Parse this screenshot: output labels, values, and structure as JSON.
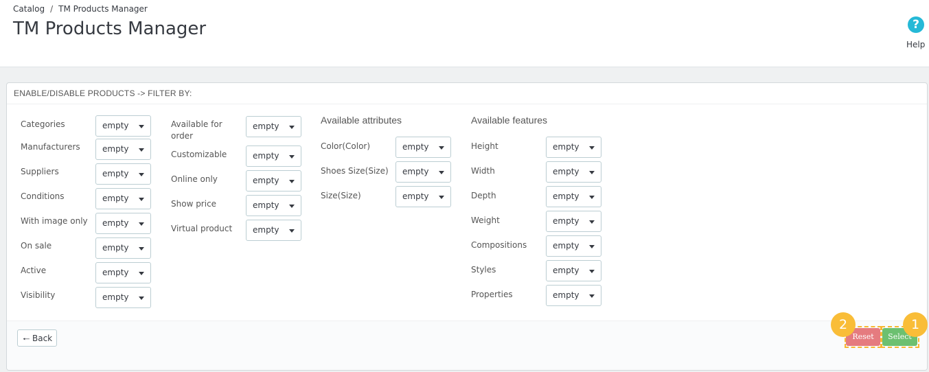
{
  "breadcrumb": {
    "parent": "Catalog",
    "separator": "/",
    "current": "TM Products Manager"
  },
  "page_title": "TM Products Manager",
  "help": {
    "icon": "?",
    "label": "Help"
  },
  "panel": {
    "heading": "ENABLE/DISABLE PRODUCTS -> FILTER BY:",
    "col1": [
      {
        "label": "Categories",
        "value": "empty"
      },
      {
        "label": "Manufacturers",
        "value": "empty"
      },
      {
        "label": "Suppliers",
        "value": "empty"
      },
      {
        "label": "Conditions",
        "value": "empty"
      },
      {
        "label": "With image only",
        "value": "empty"
      },
      {
        "label": "On sale",
        "value": "empty"
      },
      {
        "label": "Active",
        "value": "empty"
      },
      {
        "label": "Visibility",
        "value": "empty"
      }
    ],
    "col2": [
      {
        "label": "Available for order",
        "value": "empty"
      },
      {
        "label": "Customizable",
        "value": "empty"
      },
      {
        "label": "Online only",
        "value": "empty"
      },
      {
        "label": "Show price",
        "value": "empty"
      },
      {
        "label": "Virtual product",
        "value": "empty"
      }
    ],
    "attributes": {
      "title": "Available attributes",
      "items": [
        {
          "label": "Color(Color)",
          "value": "empty"
        },
        {
          "label": "Shoes Size(Size)",
          "value": "empty"
        },
        {
          "label": "Size(Size)",
          "value": "empty"
        }
      ]
    },
    "features": {
      "title": "Available features",
      "items": [
        {
          "label": "Height",
          "value": "empty"
        },
        {
          "label": "Width",
          "value": "empty"
        },
        {
          "label": "Depth",
          "value": "empty"
        },
        {
          "label": "Weight",
          "value": "empty"
        },
        {
          "label": "Compositions",
          "value": "empty"
        },
        {
          "label": "Styles",
          "value": "empty"
        },
        {
          "label": "Properties",
          "value": "empty"
        }
      ]
    }
  },
  "footer": {
    "back_label": "Back",
    "reset_label": "Reset",
    "select_label": "Select",
    "badge_reset": "2",
    "badge_select": "1"
  },
  "colors": {
    "accent": "#25b9d7",
    "reset": "#e57b7f",
    "select": "#6cc070",
    "badge": "#f9bd38"
  }
}
